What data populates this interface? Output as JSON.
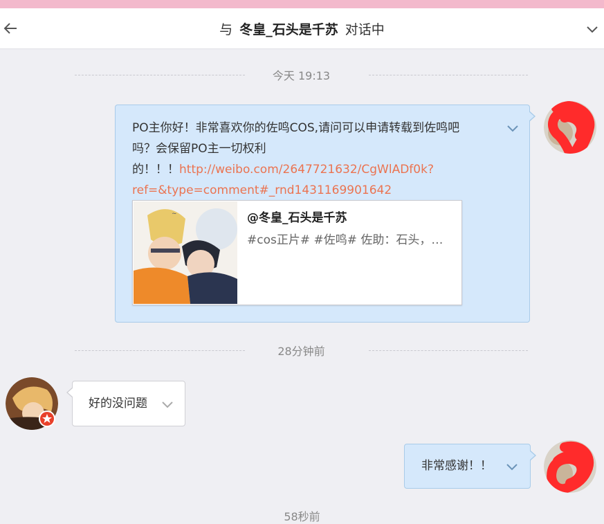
{
  "header": {
    "title_prefix": "与",
    "contact_name": "冬皇_石头是千苏",
    "title_suffix": "对话中"
  },
  "timestamps": [
    "今天 19:13",
    "28分钟前",
    "58秒前"
  ],
  "messages": [
    {
      "direction": "outgoing",
      "text_line1": "PO主你好！非常喜欢你的佐鸣COS,请问可以申请转载到佐鸣吧",
      "text_line2": "吗？会保留PO主一切权利",
      "text_line3": "的！！！",
      "link_part1": "http://weibo.com/2647721632/CgWlADf0k?",
      "link_part2": "ref=&type=comment#_rnd1431169901642",
      "card": {
        "title": "@冬皇_石头是千苏",
        "description": "#cos正片# #佐鸣# 佐助：石头，鸣…"
      }
    },
    {
      "direction": "incoming",
      "text": "好的没问题"
    },
    {
      "direction": "outgoing",
      "text": "非常感谢！！"
    }
  ],
  "colors": {
    "top_band": "#f3b9cc",
    "outgoing_bubble": "#d5e8fb",
    "link": "#eb7350",
    "badge": "#e8402a"
  },
  "icons": [
    "back-arrow-icon",
    "chevron-down-icon",
    "vip-star-badge-icon"
  ]
}
